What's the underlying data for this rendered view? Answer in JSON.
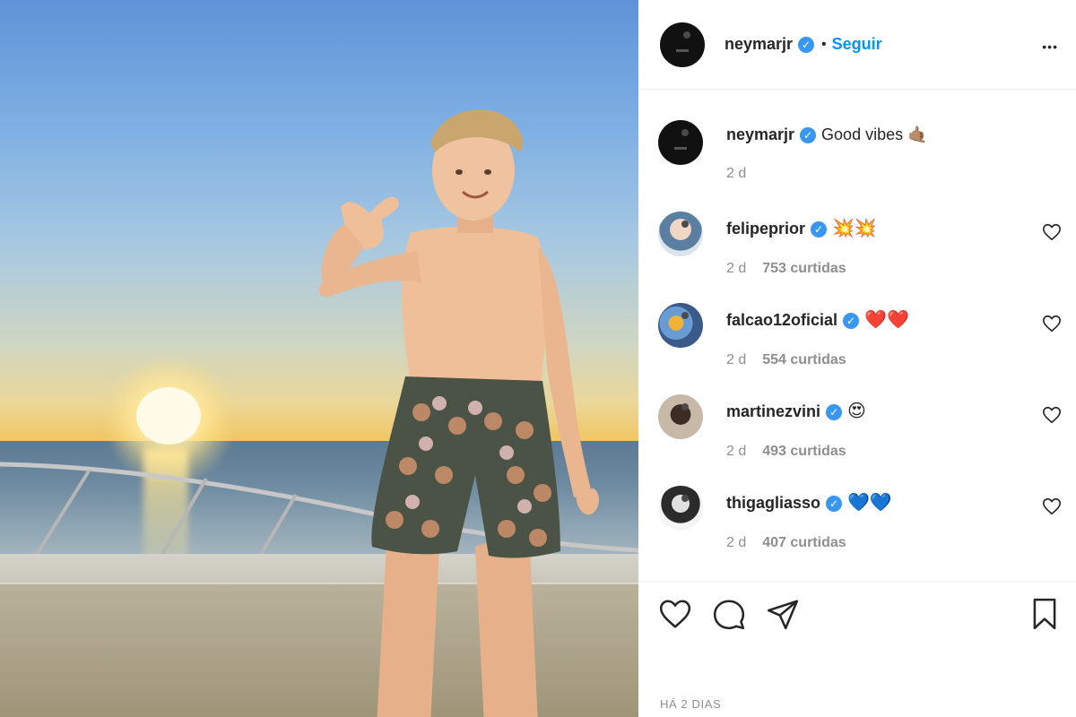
{
  "post": {
    "author": "neymarjr",
    "follow_label": "Seguir",
    "separator": "•",
    "more_glyph": "•••"
  },
  "caption": {
    "author": "neymarjr",
    "text": "Good vibes 🤙🏽",
    "time": "2 d"
  },
  "comments": [
    {
      "user": "felipeprior",
      "text": "💥💥",
      "time": "2 d",
      "likes": "753 curtidas",
      "avatar": "avatar-felipeprior"
    },
    {
      "user": "falcao12oficial",
      "text": "❤️❤️",
      "time": "2 d",
      "likes": "554 curtidas",
      "avatar": "avatar-falcao"
    },
    {
      "user": "martinezvini",
      "text": "😍",
      "time": "2 d",
      "likes": "493 curtidas",
      "avatar": "avatar-martinezvini"
    },
    {
      "user": "thigagliasso",
      "text": "💙💙",
      "time": "2 d",
      "likes": "407 curtidas",
      "avatar": "avatar-thigagliasso"
    }
  ],
  "footer": {
    "date": "HÁ 2 DIAS"
  },
  "icons": {
    "verified": "verified-badge-icon",
    "like": "heart-icon",
    "comment": "comment-icon",
    "share": "send-icon",
    "save": "bookmark-icon"
  },
  "colors": {
    "link": "#0095f6",
    "verified": "#3897f0",
    "muted": "#8e8e8e"
  }
}
